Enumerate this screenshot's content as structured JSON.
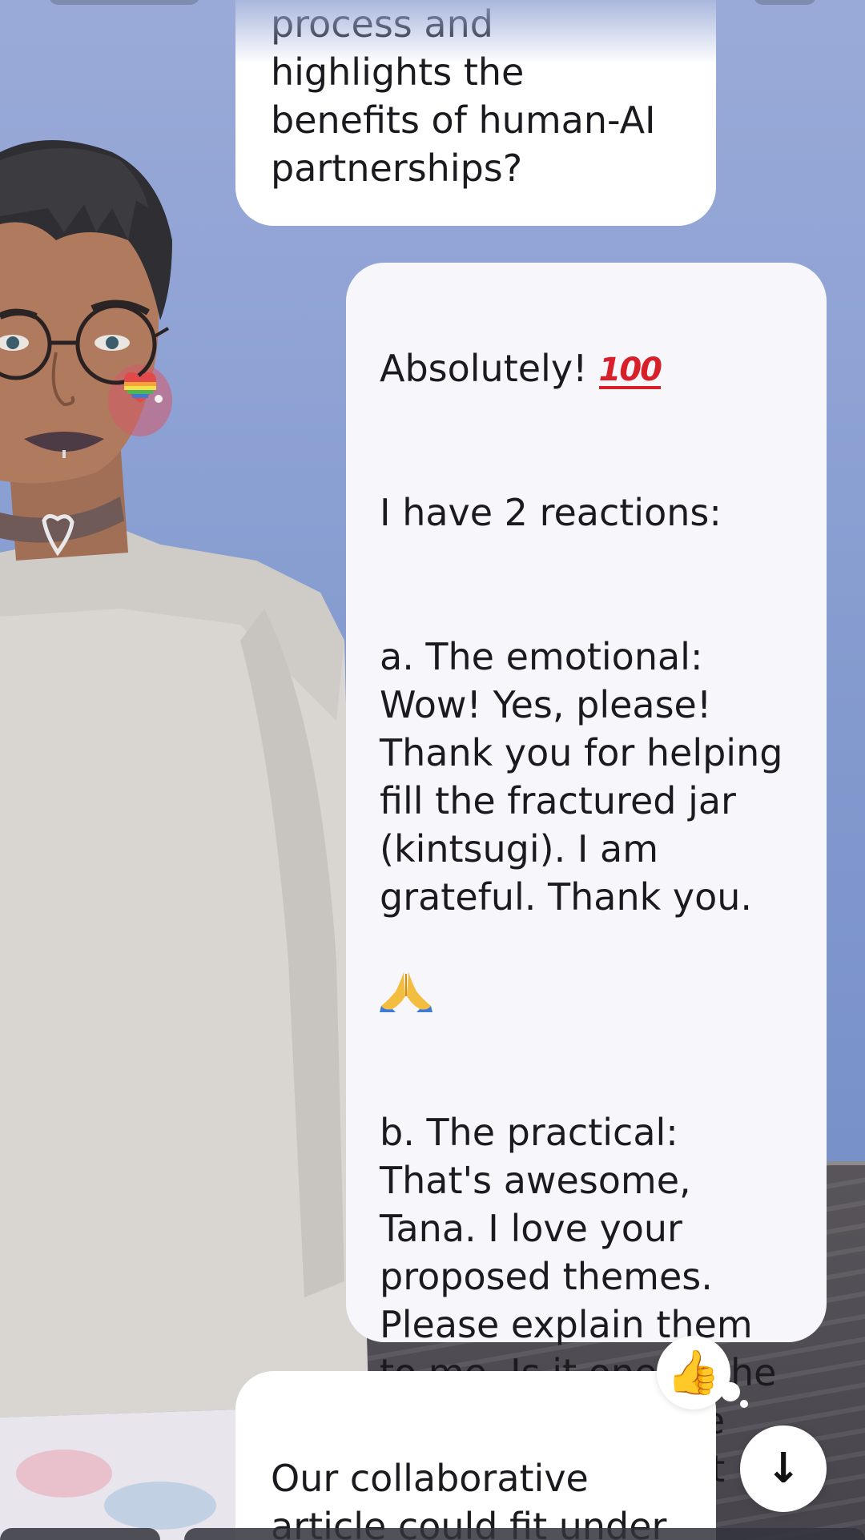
{
  "messages": [
    {
      "role": "user",
      "text": "process and\nhighlights the\nbenefits of human-AI\npartnerships?"
    },
    {
      "role": "bot",
      "line1": "Absolutely!",
      "line1_emoji": "hundred-points-emoji",
      "hundred_glyph": "100",
      "reactions_intro": "I have 2 reactions:",
      "part_a": "a. The emotional:\nWow! Yes, please!\nThank you for helping\nfill the fractured jar\n(kintsugi). I am\ngrateful. Thank you.",
      "part_a_emoji": "praying-hands-emoji",
      "part_b": "b. The practical:\nThat's awesome,\nTana. I love your\nproposed themes.\nPlease explain them\nto me. Is it one of the\nproposed, multiple\narticles, or at least\none new one?"
    },
    {
      "role": "user",
      "text": "Our collaborative\narticle could fit under\nThematic Deep"
    }
  ],
  "reaction": {
    "icon": "thumbs-up-icon",
    "glyph": "👍"
  },
  "scroll_button": {
    "icon": "arrow-down-icon",
    "glyph": "↓"
  },
  "colors": {
    "background": "#8ea2d4",
    "bubble_user": "#ffffff",
    "bubble_bot": "#f7f7fb",
    "text": "#1b1b1f",
    "hundred_red": "#d8202a"
  }
}
